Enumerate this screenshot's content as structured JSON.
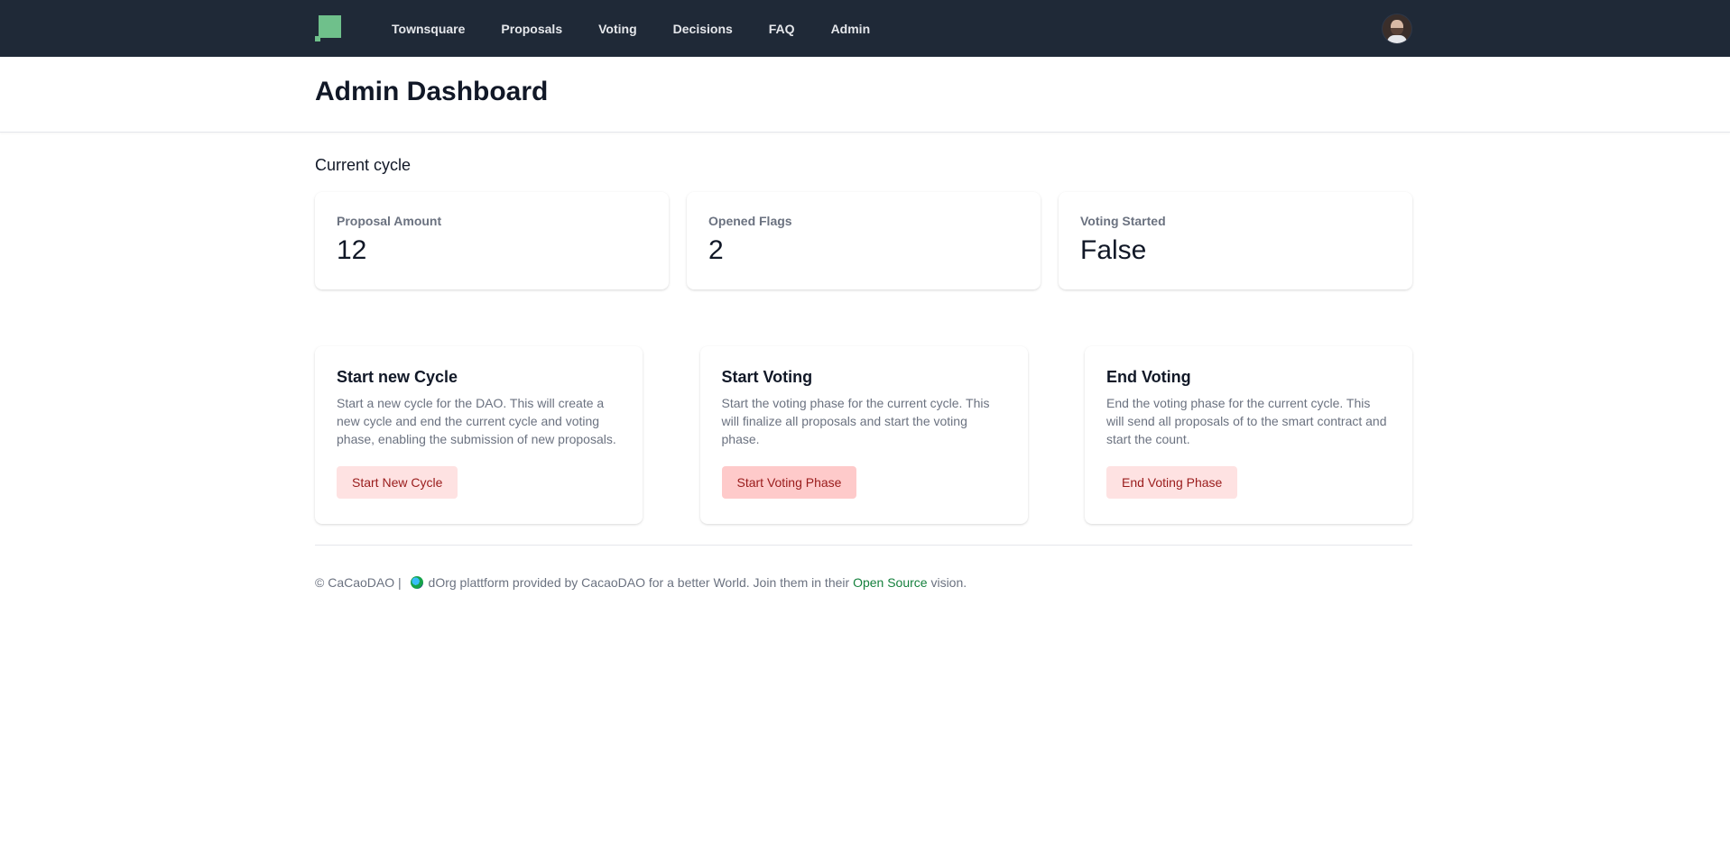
{
  "nav": {
    "logo": "app-logo",
    "links": [
      "Townsquare",
      "Proposals",
      "Voting",
      "Decisions",
      "FAQ",
      "Admin"
    ],
    "avatar": "user-avatar"
  },
  "header": {
    "title": "Admin Dashboard"
  },
  "cycle": {
    "section_title": "Current cycle",
    "stats": [
      {
        "label": "Proposal Amount",
        "value": "12"
      },
      {
        "label": "Opened Flags",
        "value": "2"
      },
      {
        "label": "Voting Started",
        "value": "False"
      }
    ]
  },
  "actions": [
    {
      "title": "Start new Cycle",
      "description": "Start a new cycle for the DAO. This will create a new cycle and end the current cycle and voting phase, enabling the submission of new proposals.",
      "button": "Start New Cycle"
    },
    {
      "title": "Start Voting",
      "description": "Start the voting phase for the current cycle. This will finalize all proposals and start the voting phase.",
      "button": "Start Voting Phase"
    },
    {
      "title": "End Voting",
      "description": "End the voting phase for the current cycle. This will send all proposals of to the smart contract and start the count.",
      "button": "End Voting Phase"
    }
  ],
  "footer": {
    "prefix": "© CaCaoDAO | ",
    "middle": "dOrg plattform provided by CacaoDAO for a better World. Join them in their ",
    "link": "Open Source",
    "suffix": " vision."
  },
  "colors": {
    "nav_bg": "#1f2937",
    "logo_green": "#6fc08b",
    "button_bg": "#fee2e2",
    "button_text": "#991b1b",
    "link_green": "#15803d"
  }
}
